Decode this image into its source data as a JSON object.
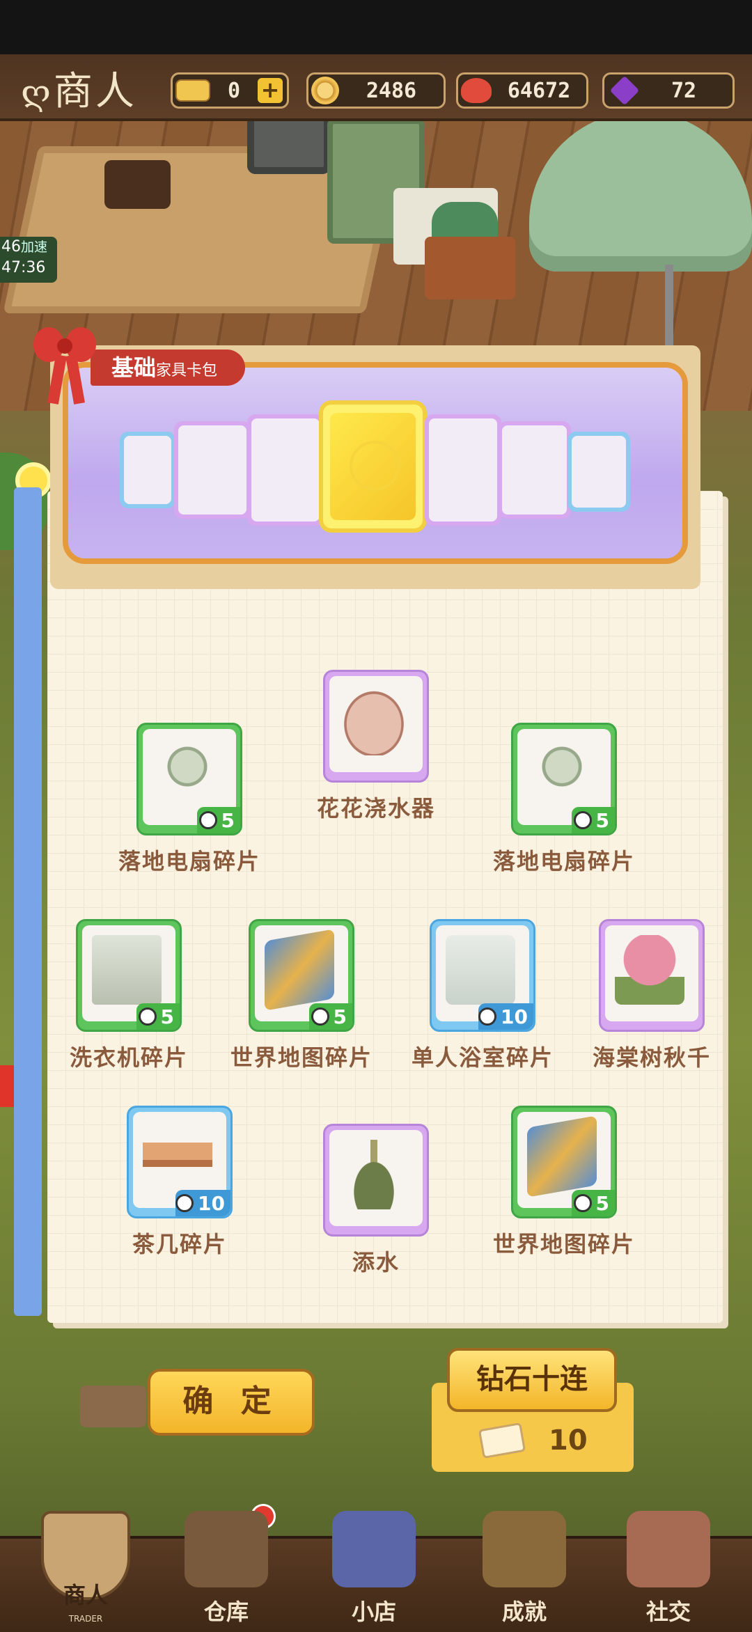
{
  "header": {
    "title": "商人",
    "resources": [
      {
        "name": "ticket",
        "value": "0",
        "icon": "ticket-icon"
      },
      {
        "name": "coin",
        "value": "2486",
        "icon": "coin-icon"
      },
      {
        "name": "heart",
        "value": "64672",
        "icon": "heart-icon"
      },
      {
        "name": "gem",
        "value": "72",
        "icon": "gem-icon"
      }
    ],
    "add_label": "+"
  },
  "side": {
    "boost_count": "46",
    "boost_label": "加速",
    "timer": "47:36"
  },
  "banner": {
    "title": "基础",
    "subtitle": "家具卡包"
  },
  "rewards": [
    {
      "label": "落地电扇碎片",
      "rarity": "green",
      "count": "5",
      "art": "fan"
    },
    {
      "label": "花花浇水器",
      "rarity": "purple",
      "count": "",
      "art": "cake"
    },
    {
      "label": "落地电扇碎片",
      "rarity": "green",
      "count": "5",
      "art": "fan"
    },
    {
      "label": "洗衣机碎片",
      "rarity": "green",
      "count": "5",
      "art": "washer"
    },
    {
      "label": "世界地图碎片",
      "rarity": "green",
      "count": "5",
      "art": "map"
    },
    {
      "label": "单人浴室碎片",
      "rarity": "blue",
      "count": "10",
      "art": "shower"
    },
    {
      "label": "海棠树秋千",
      "rarity": "purple",
      "count": "",
      "art": "tree"
    },
    {
      "label": "茶几碎片",
      "rarity": "blue",
      "count": "10",
      "art": "table"
    },
    {
      "label": "添水",
      "rarity": "purple",
      "count": "",
      "art": "water"
    },
    {
      "label": "世界地图碎片",
      "rarity": "green",
      "count": "5",
      "art": "map"
    }
  ],
  "buttons": {
    "confirm": "确 定",
    "diamond_ten": "钻石十连",
    "ticket_cost": "10"
  },
  "nav": [
    {
      "label": "商人",
      "sub": "TRADER",
      "icon": "trader-icon",
      "active": true
    },
    {
      "label": "仓库",
      "icon": "warehouse-icon"
    },
    {
      "label": "小店",
      "icon": "shop-icon"
    },
    {
      "label": "成就",
      "icon": "achievement-icon"
    },
    {
      "label": "社交",
      "icon": "social-icon"
    }
  ],
  "colors": {
    "green": "#5ec55d",
    "purple": "#d7a8ef",
    "blue": "#7ec8f2",
    "gold": "#f3c233"
  }
}
